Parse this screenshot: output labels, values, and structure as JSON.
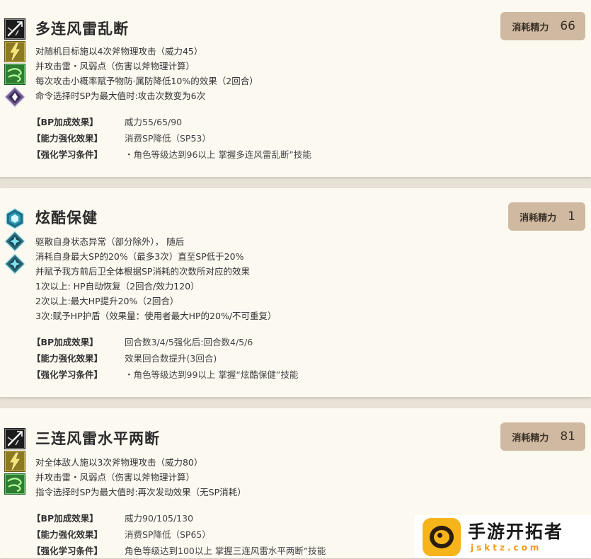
{
  "skills": [
    {
      "name": "多连风雷乱断",
      "cost_label": "消耗精力",
      "cost_value": "66",
      "icons": [
        "sword-slash-icon",
        "thunder-element-icon",
        "wind-element-icon",
        "boost-diamond-icon"
      ],
      "description": [
        "对随机目标施以4次斧物理攻击（威力45）",
        "并攻击雷・风弱点（伤害以斧物理计算）",
        "每次攻击小概率赋予物防·属防降低10%的效果（2回合）",
        "命令选择时SP为最大值时:攻击次数变为6次"
      ],
      "attributes": [
        {
          "key": "【BP加成效果】",
          "value": "威力55/65/90"
        },
        {
          "key": "【能力强化效果】",
          "value": "消费SP降低（SP53）"
        },
        {
          "key": "【强化学习条件】",
          "value": "・角色等级达到96以上 掌握多连风雷乱断”技能"
        }
      ]
    },
    {
      "name": "炫酷保健",
      "cost_label": "消耗精力",
      "cost_value": "1",
      "icons": [
        "heal-hexagon-icon",
        "support-diamond-icon",
        "support-diamond-icon"
      ],
      "description": [
        "驱散自身状态异常（部分除外）， 随后",
        "消耗自身最大SP的20%（最多3次）直至SP低于20%",
        "并赋予我方前后卫全体根据SP消耗的次数所对应的效果",
        "1次以上: HP自动恢复（2回合/效力120）",
        "2次以上:最大HP提升20%（2回合）",
        "3次:赋予HP护盾（效果量：使用者最大HP的20%/不可重复）"
      ],
      "attributes": [
        {
          "key": "【BP加成效果】",
          "value": "回合数3/4/5强化后:回合数4/5/6"
        },
        {
          "key": "【能力强化效果】",
          "value": "效果回合数提升(3回合)"
        },
        {
          "key": "【强化学习条件】",
          "value": "・角色等级达到99以上 掌握“炫酷保健”技能"
        }
      ]
    },
    {
      "name": "三连风雷水平两断",
      "cost_label": "消耗精力",
      "cost_value": "81",
      "icons": [
        "sword-slash-icon",
        "thunder-element-icon",
        "wind-element-icon"
      ],
      "description": [
        "对全体敌人施以3次斧物理攻击（威力80）",
        "并攻击雷・风弱点（伤害以斧物理计算）",
        "指令选择时SP为最大值时:再次发动效果（无SP消耗）"
      ],
      "attributes": [
        {
          "key": "【BP加成效果】",
          "value": "威力90/105/130"
        },
        {
          "key": "【能力强化效果】",
          "value": "消费SP降低（SP65）"
        },
        {
          "key": "【强化学习条件】",
          "value": "角色等级达到100以上 掌握三连风雷水平两断”技能"
        }
      ]
    }
  ],
  "watermark": {
    "title": "手游开拓者",
    "url": "jsktz.com"
  },
  "colors": {
    "card_bg": "#fcf9f1",
    "page_bg": "#e7e1d6",
    "badge_bg": "#cfb9a0",
    "watermark_accent": "#f6b41b"
  }
}
